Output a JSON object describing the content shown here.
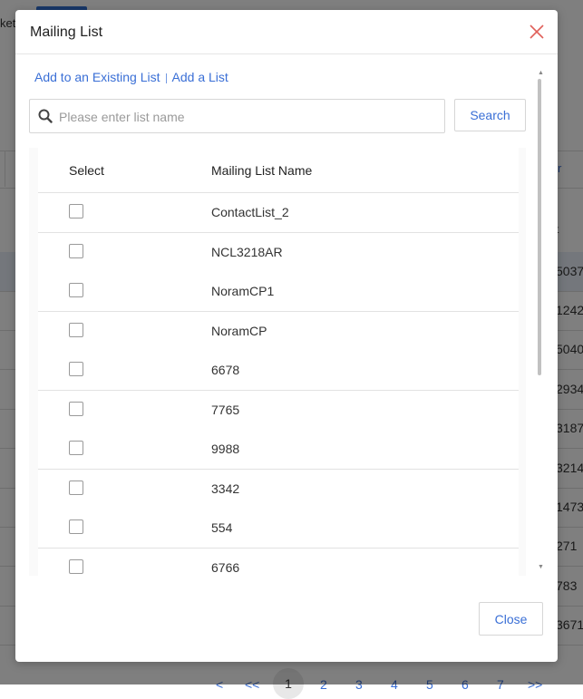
{
  "background": {
    "left_text": "ket",
    "header_link": "r",
    "row_marker": "t",
    "row_values": [
      "5037",
      "1242",
      "5040",
      "2934",
      "3187",
      "3214",
      "1473",
      "271",
      "783",
      "3671"
    ],
    "pagination": [
      "<",
      "<<",
      "1",
      "2",
      "3",
      "4",
      "5",
      "6",
      "7",
      ">>"
    ]
  },
  "modal": {
    "title": "Mailing List",
    "close_icon": "close-icon",
    "tabs": {
      "existing": "Add to an Existing List",
      "add": "Add a List"
    },
    "search": {
      "placeholder": "Please enter list name",
      "value": "",
      "button": "Search"
    },
    "table": {
      "columns": [
        "Select",
        "Mailing List Name"
      ],
      "rows": [
        {
          "name": "ContactList_2",
          "checked": false
        },
        {
          "name": "NCL3218AR",
          "checked": false
        },
        {
          "name": "NoramCP1",
          "checked": false
        },
        {
          "name": "NoramCP",
          "checked": false
        },
        {
          "name": "6678",
          "checked": false
        },
        {
          "name": "7765",
          "checked": false
        },
        {
          "name": "9988",
          "checked": false
        },
        {
          "name": "3342",
          "checked": false
        },
        {
          "name": "554",
          "checked": false
        },
        {
          "name": "6766",
          "checked": false
        }
      ]
    },
    "footer": {
      "close_button": "Close"
    }
  },
  "colors": {
    "accent": "#3a6fd6",
    "close_icon": "#e0605a",
    "overlay": "rgba(0,0,0,0.5)"
  }
}
